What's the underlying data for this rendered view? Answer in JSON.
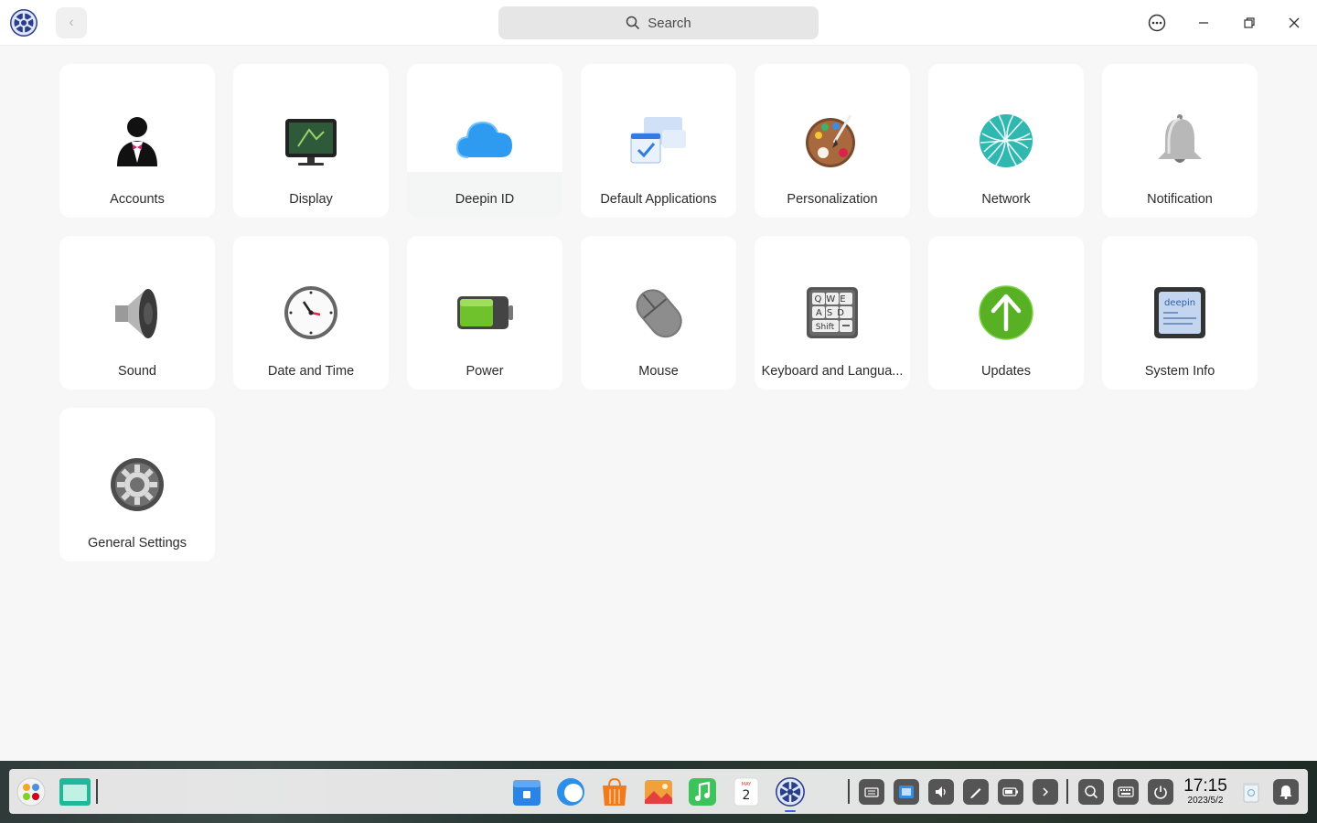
{
  "search": {
    "placeholder": "Search"
  },
  "tiles": [
    {
      "label": "Accounts",
      "icon": "accounts-icon"
    },
    {
      "label": "Display",
      "icon": "display-icon"
    },
    {
      "label": "Deepin ID",
      "icon": "cloud-icon"
    },
    {
      "label": "Default Applications",
      "icon": "default-apps-icon"
    },
    {
      "label": "Personalization",
      "icon": "palette-icon"
    },
    {
      "label": "Network",
      "icon": "network-globe-icon"
    },
    {
      "label": "Notification",
      "icon": "bell-icon"
    },
    {
      "label": "Sound",
      "icon": "speaker-icon"
    },
    {
      "label": "Date and Time",
      "icon": "clock-icon"
    },
    {
      "label": "Power",
      "icon": "battery-icon"
    },
    {
      "label": "Mouse",
      "icon": "mouse-icon"
    },
    {
      "label": "Keyboard and Langua...",
      "icon": "keyboard-icon"
    },
    {
      "label": "Updates",
      "icon": "update-arrow-icon"
    },
    {
      "label": "System Info",
      "icon": "system-info-icon"
    },
    {
      "label": "General Settings",
      "icon": "gear-icon"
    }
  ],
  "keyboard_icon_text": {
    "row1": "QWE",
    "row2": "ASD",
    "row3": "Shift"
  },
  "system_info_icon_text": "deepin",
  "dock": {
    "calendar_month": "MAY",
    "calendar_day": "2",
    "time": "17:15",
    "date": "2023/5/2"
  },
  "colors": {
    "accent": "#2b6de8",
    "updates_green": "#58b024",
    "cloud_blue": "#2f9bf0",
    "battery_green": "#6fc22b"
  }
}
